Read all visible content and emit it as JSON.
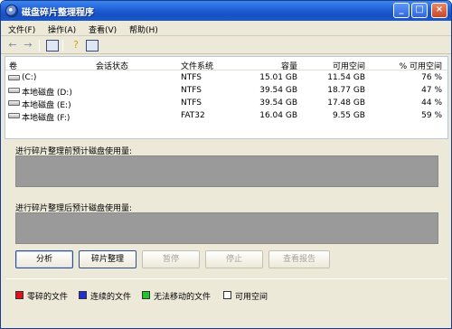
{
  "window": {
    "title": "磁盘碎片整理程序"
  },
  "menubar": {
    "items": [
      {
        "label": "文件(F)"
      },
      {
        "label": "操作(A)"
      },
      {
        "label": "查看(V)"
      },
      {
        "label": "帮助(H)"
      }
    ]
  },
  "toolbar": {
    "icons": [
      "back-arrow-icon",
      "forward-arrow-icon",
      "properties-icon",
      "help-icon",
      "pane-icon"
    ]
  },
  "volume_list": {
    "headers": [
      "卷",
      "会话状态",
      "文件系统",
      "容量",
      "可用空间",
      "% 可用空间"
    ],
    "rows": [
      {
        "volume": "(C:)",
        "status": "",
        "fs": "NTFS",
        "capacity": "15.01 GB",
        "free": "11.54 GB",
        "free_pct": "76 %"
      },
      {
        "volume": "本地磁盘 (D:)",
        "status": "",
        "fs": "NTFS",
        "capacity": "39.54 GB",
        "free": "18.77 GB",
        "free_pct": "47 %"
      },
      {
        "volume": "本地磁盘 (E:)",
        "status": "",
        "fs": "NTFS",
        "capacity": "39.54 GB",
        "free": "17.48 GB",
        "free_pct": "44 %"
      },
      {
        "volume": "本地磁盘 (F:)",
        "status": "",
        "fs": "FAT32",
        "capacity": "16.04 GB",
        "free": "9.55 GB",
        "free_pct": "59 %"
      }
    ]
  },
  "analysis": {
    "before_label": "进行碎片整理前预计磁盘使用量:",
    "after_label": "进行碎片整理后预计磁盘使用量:"
  },
  "buttons": {
    "analyze": "分析",
    "defragment": "碎片整理",
    "pause": "暂停",
    "stop": "停止",
    "view_report": "查看报告"
  },
  "legend": [
    {
      "label": "零碎的文件",
      "color": "#e0101d"
    },
    {
      "label": "连续的文件",
      "color": "#1f2fd0"
    },
    {
      "label": "无法移动的文件",
      "color": "#22c42e"
    },
    {
      "label": "可用空间",
      "color": "#ffffff"
    }
  ]
}
